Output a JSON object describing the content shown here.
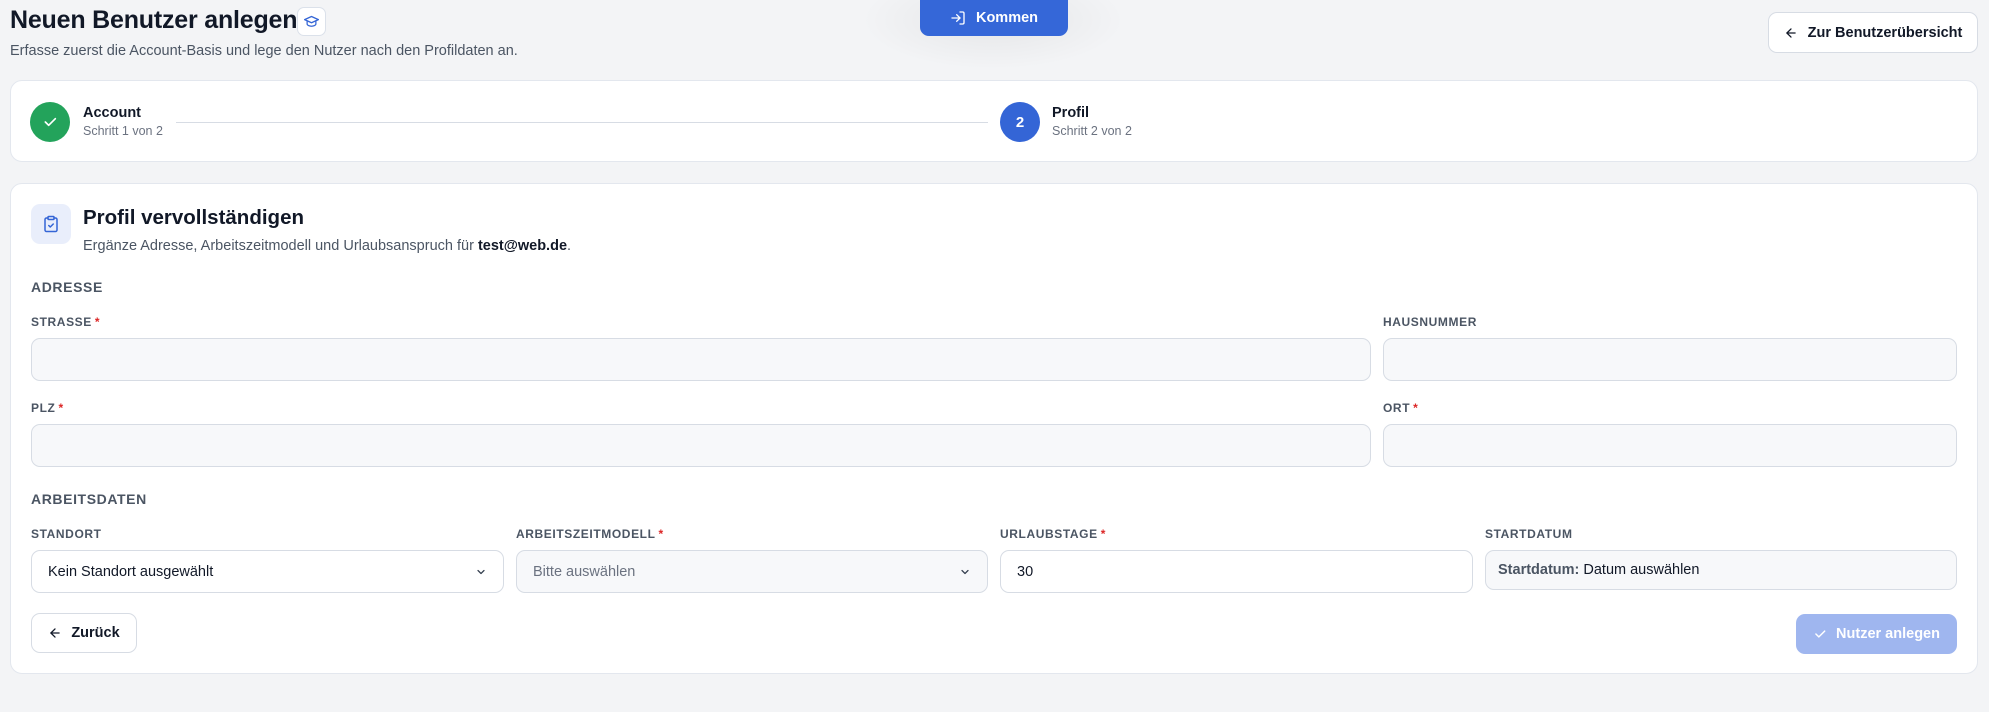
{
  "header": {
    "title": "Neuen Benutzer anlegen",
    "title_icon": "graduation-cap-icon",
    "subtitle": "Erfasse zuerst die Account-Basis und lege den Nutzer nach den Profildaten an.",
    "clock_in_button": "Kommen",
    "back_overview_button": "Zur Benutzerübersicht"
  },
  "stepper": {
    "steps": [
      {
        "title": "Account",
        "subtitle": "Schritt 1 von 2",
        "status": "completed",
        "icon": "check-icon"
      },
      {
        "number": "2",
        "title": "Profil",
        "subtitle": "Schritt 2 von 2",
        "status": "active"
      }
    ]
  },
  "form": {
    "title": "Profil vervollständigen",
    "icon": "clipboard-check-icon",
    "description_prefix": "Ergänze Adresse, Arbeitszeitmodell und Urlaubsanspruch für ",
    "email": "test@web.de",
    "description_suffix": ".",
    "address": {
      "heading": "ADRESSE",
      "street_label": "STRASSE",
      "street_value": "",
      "house_number_label": "HAUSNUMMER",
      "house_number_value": "",
      "zip_label": "PLZ",
      "zip_value": "",
      "city_label": "ORT",
      "city_value": ""
    },
    "work": {
      "heading": "ARBEITSDATEN",
      "location_label": "STANDORT",
      "location_value": "Kein Standort ausgewählt",
      "work_model_label": "ARBEITSZEITMODELL",
      "work_model_placeholder": "Bitte auswählen",
      "vacation_label": "URLAUBSTAGE",
      "vacation_value": "30",
      "start_date_label": "STARTDATUM",
      "start_date_key": "Startdatum:",
      "start_date_value": "Datum auswählen"
    },
    "required_marker": "*",
    "back_button": "Zurück",
    "submit_button": "Nutzer anlegen"
  },
  "colors": {
    "primary": "#3465d6",
    "success": "#23a35b",
    "required": "#dc2626",
    "submit_disabled": "#9fb6ef"
  }
}
